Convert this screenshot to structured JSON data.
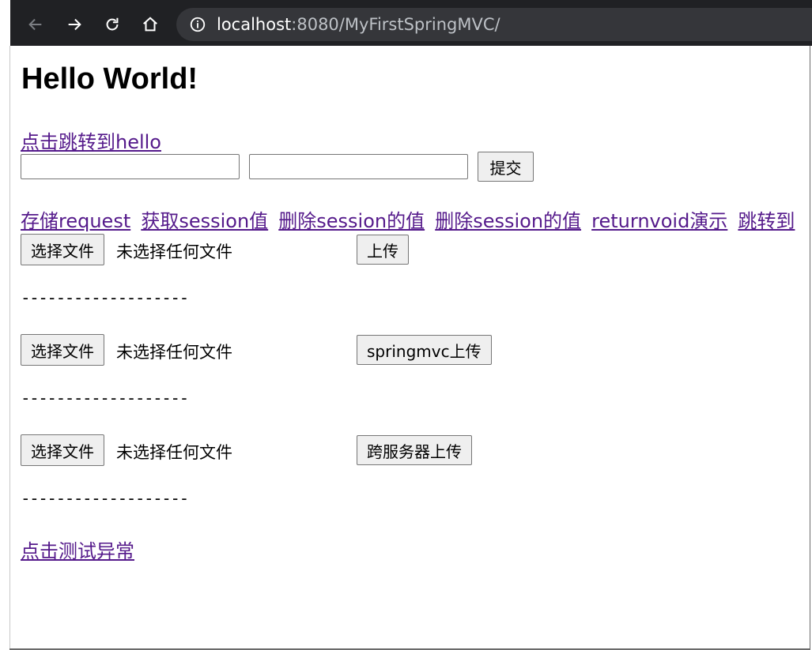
{
  "browser": {
    "url_host": "localhost",
    "url_rest": ":8080/MyFirstSpringMVC/"
  },
  "page": {
    "heading": "Hello World!",
    "hello_link": "点击跳转到hello",
    "submit_label": "提交",
    "links": [
      "存储request",
      "获取session值",
      "删除session的值",
      "删除session的值",
      "returnvoid演示",
      "跳转到"
    ],
    "uploads": [
      {
        "choose_label": "选择文件",
        "status": "未选择任何文件",
        "upload_label": "上传"
      },
      {
        "choose_label": "选择文件",
        "status": "未选择任何文件",
        "upload_label": "springmvc上传"
      },
      {
        "choose_label": "选择文件",
        "status": "未选择任何文件",
        "upload_label": "跨服务器上传"
      }
    ],
    "divider": "-------------------",
    "exception_link": "点击测试异常"
  }
}
